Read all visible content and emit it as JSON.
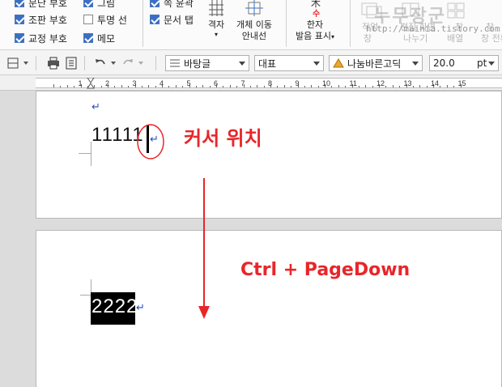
{
  "ribbon": {
    "col1": [
      {
        "label": "문단 부호",
        "checked": true
      },
      {
        "label": "조판 부호",
        "checked": true
      },
      {
        "label": "교정 부호",
        "checked": true
      }
    ],
    "col2": [
      {
        "label": "그림",
        "checked": true
      },
      {
        "label": "투명 선",
        "checked": false
      },
      {
        "label": "메모",
        "checked": true
      }
    ],
    "col3": [
      {
        "label": "쪽 윤곽",
        "checked": true
      },
      {
        "label": "문서 탭",
        "checked": true
      }
    ],
    "grid_label": "격자",
    "grid_arrow": "▾",
    "object_move_line1": "개체 이동",
    "object_move_line2": "안내선",
    "hanja_line1": "한자",
    "hanja_line2": "발음 표시",
    "hanja_arrow": "▾",
    "faded_items": [
      "작업",
      "편집 화면",
      "창",
      "창",
      "나누기",
      "배열",
      "창 전환"
    ],
    "watermark_text": "누무장군",
    "watermark_url": "http://mainia.tistory.com"
  },
  "toolbar": {
    "style_value": "바탕글",
    "lang_value": "대표",
    "font_value": "나눔바른고딕",
    "size_value": "20.0",
    "size_unit": "pt"
  },
  "ruler": {
    "numbers": [
      "1",
      "2",
      "3",
      "4",
      "5",
      "6",
      "7",
      "8",
      "9",
      "10",
      "11",
      "12",
      "13",
      "14",
      "15"
    ]
  },
  "document": {
    "page1_text": "11111",
    "page2_text": "2222",
    "para_mark": "↵",
    "annotation_cursor": "커서 위치",
    "annotation_shortcut": "Ctrl + PageDown"
  },
  "colors": {
    "annotation": "#e8262a",
    "para_mark": "#2b4fb8",
    "selection_bg": "#000000"
  }
}
